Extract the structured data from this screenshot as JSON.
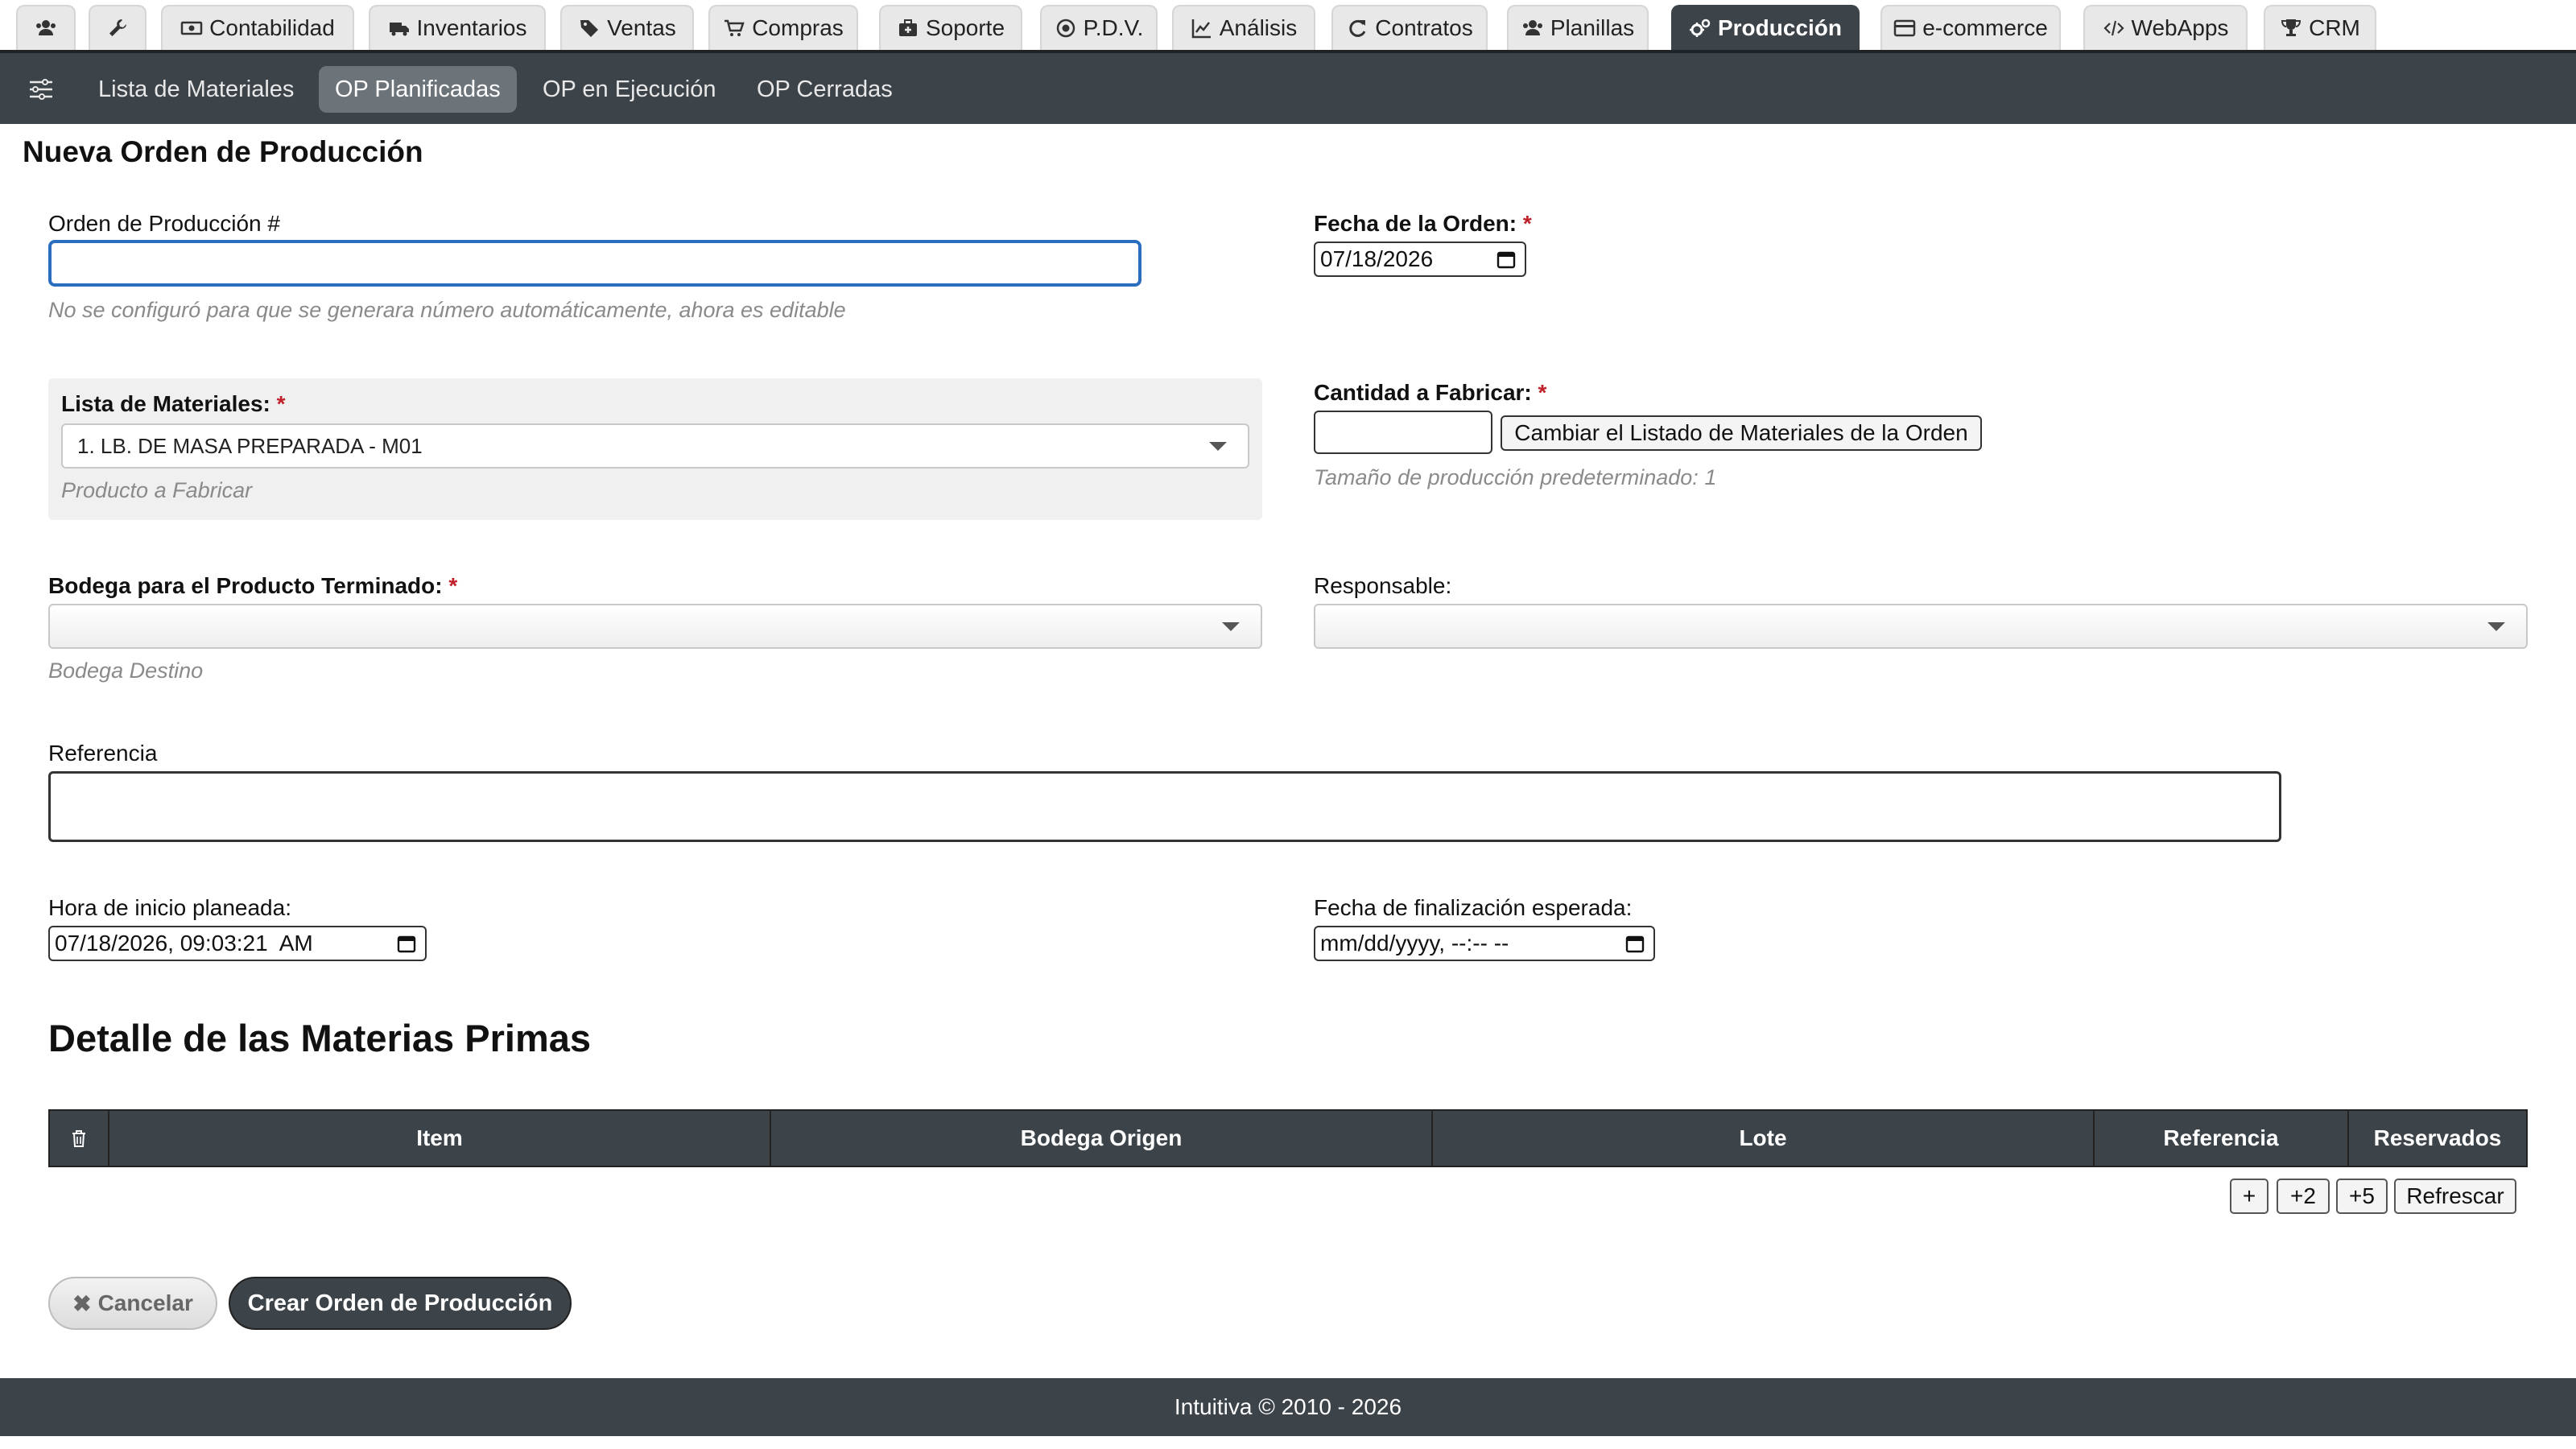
{
  "top_tabs": [
    {
      "id": "users",
      "label": ""
    },
    {
      "id": "tools",
      "label": ""
    },
    {
      "id": "contabilidad",
      "label": "Contabilidad"
    },
    {
      "id": "inventarios",
      "label": "Inventarios"
    },
    {
      "id": "ventas",
      "label": "Ventas"
    },
    {
      "id": "compras",
      "label": "Compras"
    },
    {
      "id": "soporte",
      "label": "Soporte"
    },
    {
      "id": "pdv",
      "label": "P.D.V."
    },
    {
      "id": "analisis",
      "label": "Análisis"
    },
    {
      "id": "contratos",
      "label": "Contratos"
    },
    {
      "id": "planillas",
      "label": "Planillas"
    },
    {
      "id": "produccion",
      "label": "Producción",
      "active": true
    },
    {
      "id": "ecommerce",
      "label": "e-commerce"
    },
    {
      "id": "webapps",
      "label": "WebApps"
    },
    {
      "id": "crm",
      "label": "CRM"
    }
  ],
  "sub_nav": [
    {
      "label": "Lista de Materiales"
    },
    {
      "label": "OP Planificadas",
      "active": true
    },
    {
      "label": "OP en Ejecución"
    },
    {
      "label": "OP Cerradas"
    }
  ],
  "form": {
    "title": "Nueva Orden de Producción",
    "order_number": {
      "label": "Orden de Producción #",
      "value": "",
      "help": "No se configuró para que se generara número automáticamente, ahora es editable"
    },
    "order_date": {
      "label": "Fecha de la Orden:",
      "required_mark": "*",
      "value": "07/18/2026"
    },
    "bom": {
      "label": "Lista de Materiales:",
      "required_mark": "*",
      "selected": "1. LB. DE MASA PREPARADA - M01",
      "help": "Producto a Fabricar"
    },
    "quantity": {
      "label": "Cantidad a Fabricar:",
      "required_mark": "*",
      "value": "",
      "change_button": "Cambiar el Listado de Materiales de la Orden",
      "help": "Tamaño de producción predeterminado: 1"
    },
    "warehouse": {
      "label": "Bodega para el Producto Terminado:",
      "required_mark": "*",
      "selected": "",
      "help": "Bodega Destino"
    },
    "responsible": {
      "label": "Responsable:",
      "selected": ""
    },
    "reference": {
      "label": "Referencia",
      "value": ""
    },
    "start_time": {
      "label": "Hora de inicio planeada:",
      "value": "07/18/2026, 09:03:21  AM"
    },
    "end_date": {
      "label": "Fecha de finalización esperada:",
      "value": "mm/dd/yyyy, --:-- --"
    }
  },
  "materials": {
    "title": "Detalle de las Materias Primas",
    "columns": [
      "Item",
      "Bodega Origen",
      "Lote",
      "Referencia",
      "Reservados"
    ],
    "rows": [],
    "buttons": {
      "add1": "+",
      "add2": "+2",
      "add5": "+5",
      "refresh": "Refrescar"
    }
  },
  "actions": {
    "cancel": "Cancelar",
    "create": "Crear Orden de Producción"
  },
  "footer": {
    "text": "Intuitiva © 2010 - 2026"
  },
  "colors": {
    "dark": "#3d4449",
    "required": "#c0202a",
    "focus": "#2a6fbf"
  }
}
